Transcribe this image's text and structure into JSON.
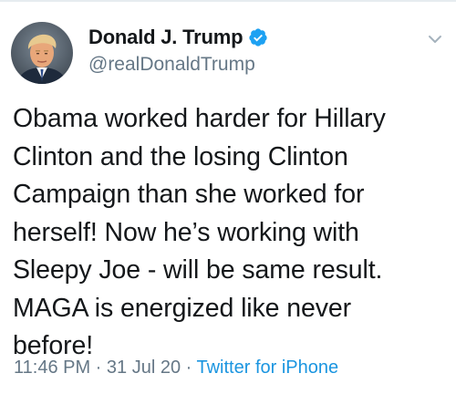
{
  "tweet": {
    "author": {
      "display_name": "Donald J. Trump",
      "handle": "@realDonaldTrump",
      "verified": true,
      "avatar_icon": "profile-photo"
    },
    "text_lines": [
      "Obama worked harder for Hillary",
      "Clinton and the losing Clinton",
      "Campaign than she worked for",
      "herself! Now he’s working with",
      "Sleepy Joe - will be same result.",
      "MAGA is energized like never",
      "before!"
    ],
    "meta": {
      "time": "11:46 PM",
      "separator": " · ",
      "date": "31 Jul 20",
      "source": "Twitter for iPhone"
    },
    "menu_icon": "chevron-down-icon",
    "colors": {
      "verified_blue": "#1da1f2",
      "link_blue": "#1b95e0",
      "secondary_text": "#657786",
      "primary_text": "#14171a"
    }
  }
}
